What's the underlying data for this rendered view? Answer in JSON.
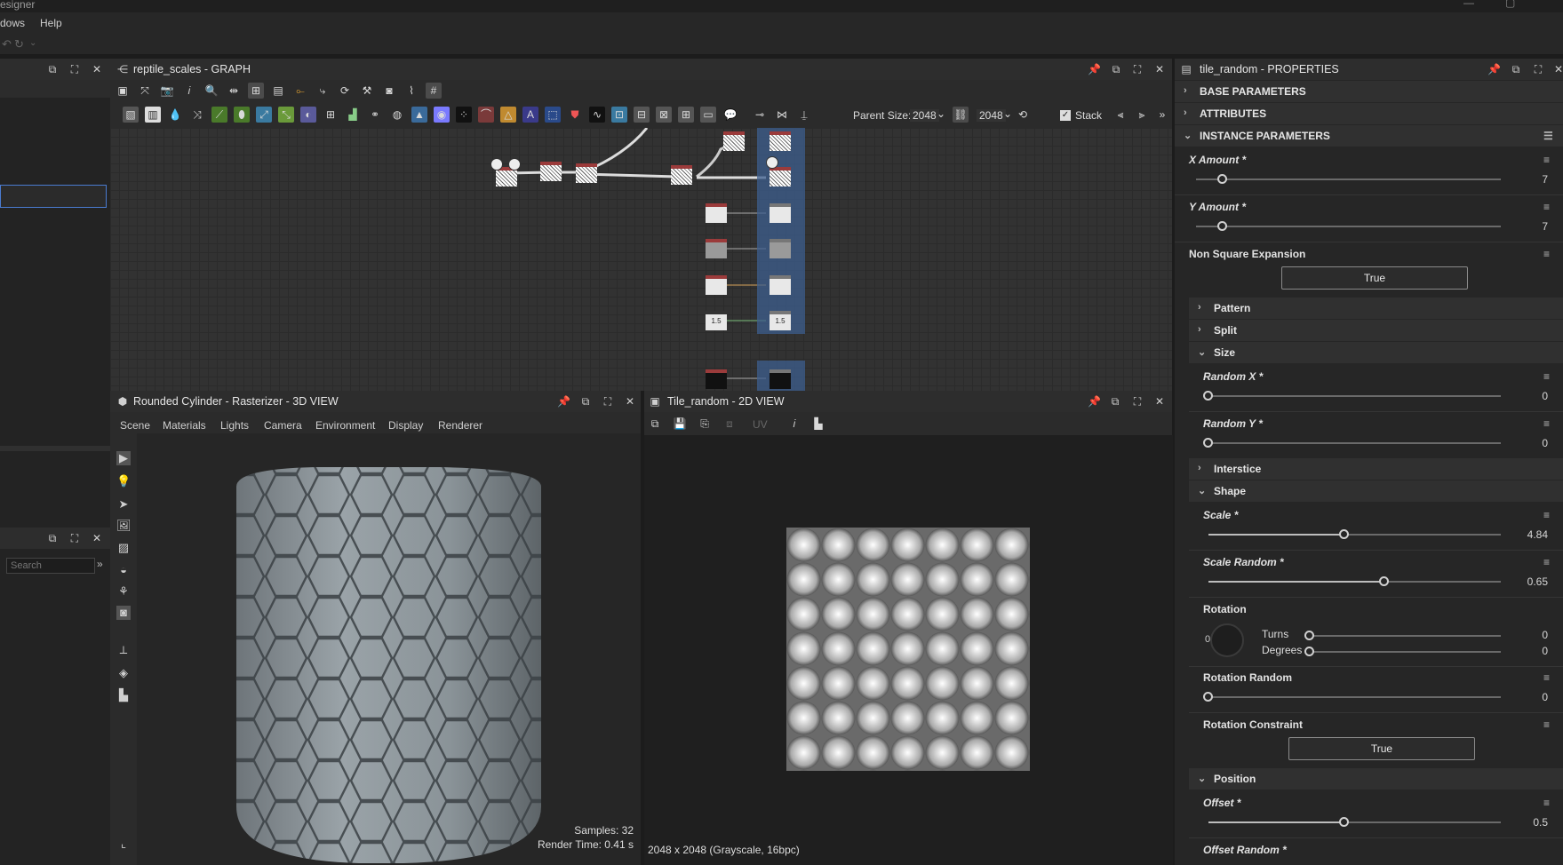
{
  "app": {
    "title_fragment": "esigner"
  },
  "menu": {
    "windows": "dows",
    "help": "Help"
  },
  "graph_panel": {
    "title": "reptile_scales - GRAPH",
    "parent_size_label": "Parent Size:",
    "parent_size_value": "2048",
    "size_value": "2048",
    "stack_label": "Stack",
    "node_labels": [
      "1.5",
      "1.5"
    ]
  },
  "left_panel": {
    "search_placeholder": "Search"
  },
  "view3d": {
    "title": "Rounded Cylinder - Rasterizer - 3D VIEW",
    "menu": [
      "Scene",
      "Materials",
      "Lights",
      "Camera",
      "Environment",
      "Display",
      "Renderer"
    ],
    "samples": "Samples: 32",
    "render_time": "Render Time: 0.41 s"
  },
  "view2d": {
    "title": "Tile_random - 2D VIEW",
    "uv_label": "UV",
    "status": "2048 x 2048 (Grayscale, 16bpc)"
  },
  "props": {
    "title": "tile_random - PROPERTIES",
    "sections": {
      "base": "BASE PARAMETERS",
      "attributes": "ATTRIBUTES",
      "instance": "INSTANCE PARAMETERS"
    },
    "x_amount": {
      "label": "X Amount *",
      "value": "7",
      "fraction": 0.1
    },
    "y_amount": {
      "label": "Y Amount *",
      "value": "7",
      "fraction": 0.1
    },
    "non_square": {
      "label": "Non Square Expansion",
      "button": "True"
    },
    "groups": {
      "pattern": "Pattern",
      "split": "Split",
      "size": "Size",
      "interstice": "Interstice",
      "shape": "Shape",
      "position": "Position"
    },
    "random_x": {
      "label": "Random X *",
      "value": "0",
      "fraction": 0
    },
    "random_y": {
      "label": "Random Y *",
      "value": "0",
      "fraction": 0
    },
    "scale": {
      "label": "Scale *",
      "value": "4.84",
      "fraction": 0.5
    },
    "scale_random": {
      "label": "Scale Random *",
      "value": "0.65",
      "fraction": 0.65
    },
    "rotation": {
      "label": "Rotation",
      "dial_value": "0",
      "turns_label": "Turns",
      "turns_value": "0",
      "degrees_label": "Degrees",
      "degrees_value": "0"
    },
    "rotation_random": {
      "label": "Rotation Random",
      "value": "0",
      "fraction": 0
    },
    "rotation_constraint": {
      "label": "Rotation Constraint",
      "button": "True"
    },
    "offset": {
      "label": "Offset *",
      "value": "0.5",
      "fraction": 0.5
    },
    "offset_random": {
      "label": "Offset Random *"
    }
  }
}
